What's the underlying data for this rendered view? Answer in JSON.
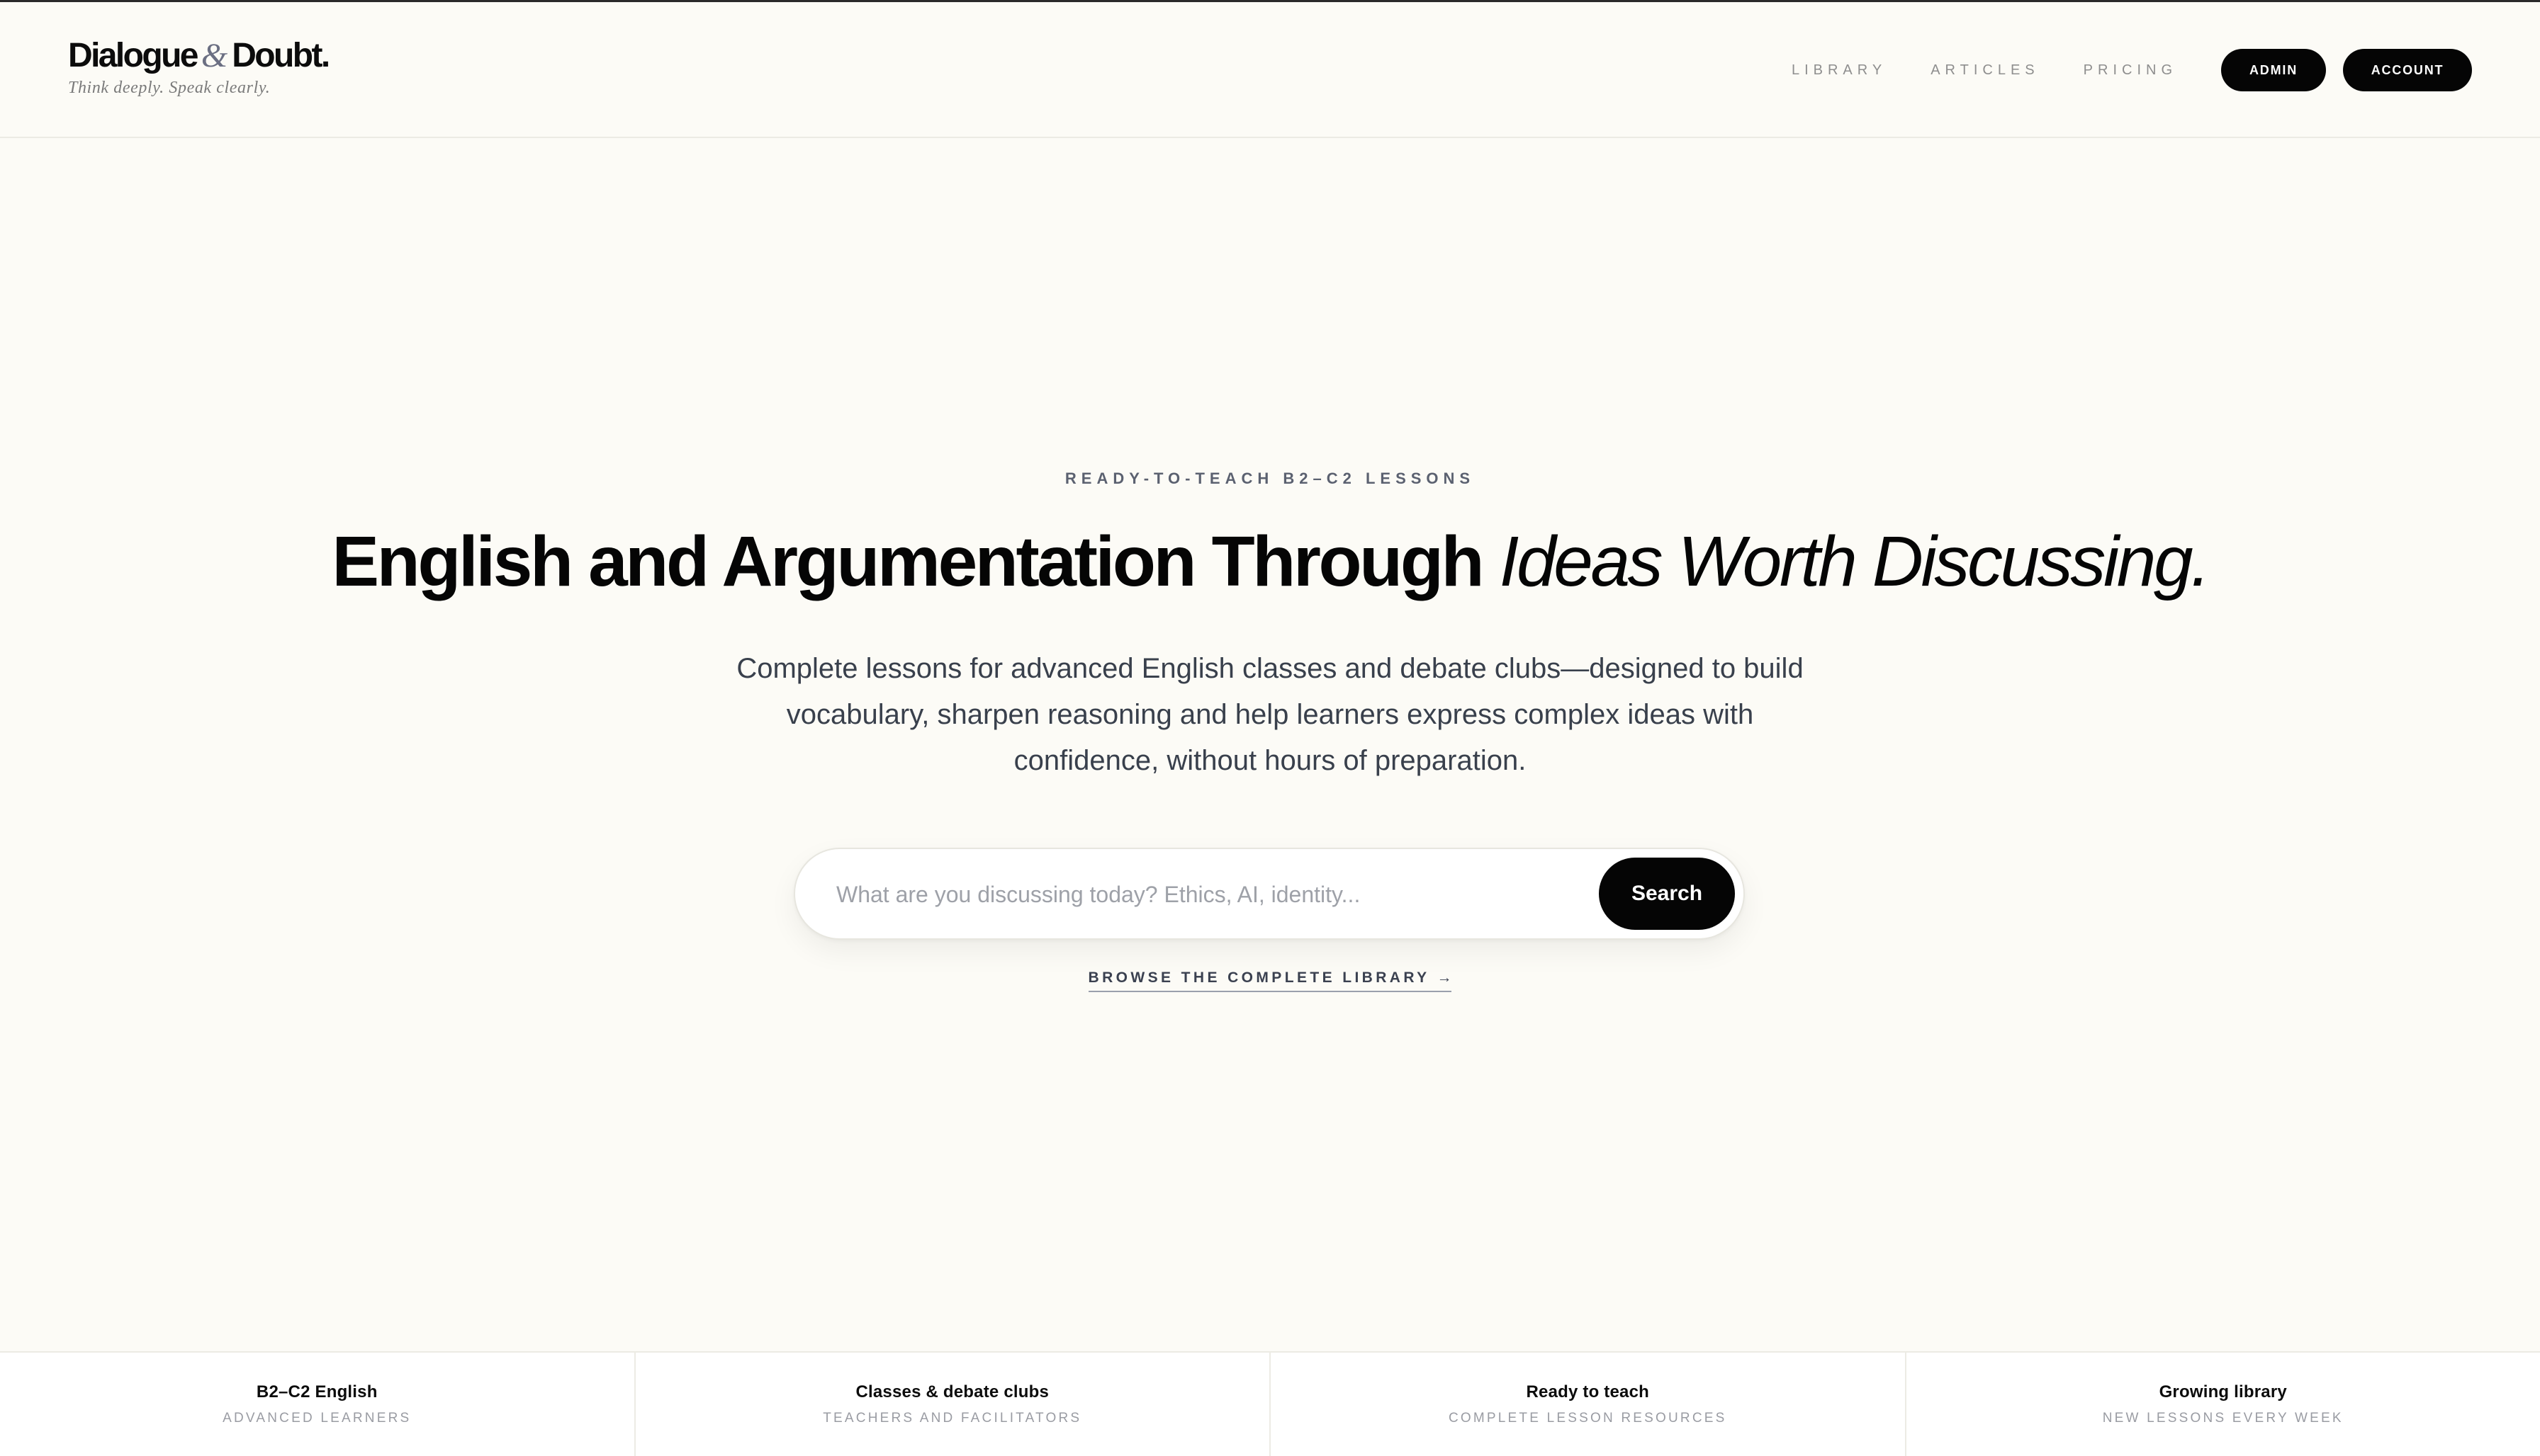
{
  "brand": {
    "name_part1": "Dialogue",
    "ampersand": "&",
    "name_part2": "Doubt.",
    "tagline": "Think deeply. Speak clearly."
  },
  "nav": {
    "links": [
      "LIBRARY",
      "ARTICLES",
      "PRICING"
    ],
    "admin_label": "ADMIN",
    "account_label": "ACCOUNT"
  },
  "hero": {
    "eyebrow": "READY-TO-TEACH B2–C2 LESSONS",
    "headline_plain": "English and Argumentation Through ",
    "headline_italic": "Ideas Worth Discussing.",
    "subhead": "Complete lessons for advanced English classes and debate clubs—designed to build vocabulary, sharpen reasoning and help learners express complex ideas with confidence, without hours of preparation."
  },
  "search": {
    "placeholder": "What are you discussing today? Ethics, AI, identity...",
    "value": "",
    "button_label": "Search"
  },
  "browse": {
    "label": "BROWSE THE COMPLETE LIBRARY",
    "arrow": "→"
  },
  "stats": [
    {
      "title": "B2–C2 English",
      "subtitle": "ADVANCED LEARNERS"
    },
    {
      "title": "Classes & debate clubs",
      "subtitle": "TEACHERS AND FACILITATORS"
    },
    {
      "title": "Ready to teach",
      "subtitle": "COMPLETE LESSON RESOURCES"
    },
    {
      "title": "Growing library",
      "subtitle": "NEW LESSONS EVERY WEEK"
    }
  ],
  "colors": {
    "background": "#fcfbf6",
    "text": "#0c0c0c",
    "button": "#050505",
    "muted": "#8e8e8e"
  }
}
